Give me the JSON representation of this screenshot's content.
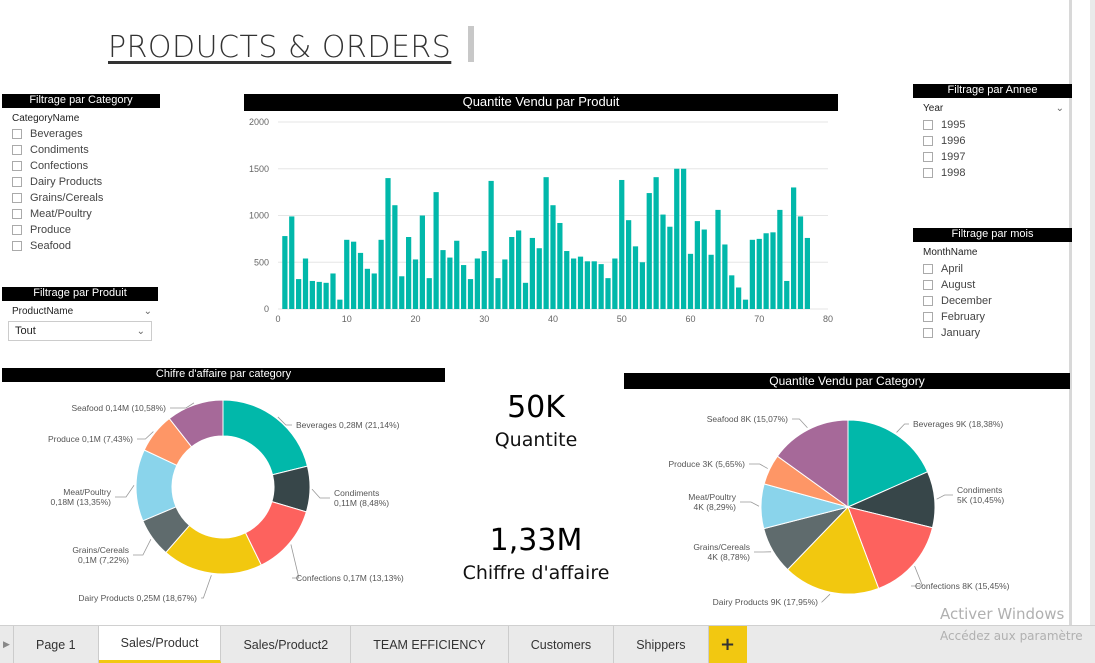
{
  "page": {
    "title": "PRODUCTS & ORDERS"
  },
  "filters": {
    "category": {
      "header": "Filtrage par Category",
      "field_label": "CategoryName",
      "items": [
        "Beverages",
        "Condiments",
        "Confections",
        "Dairy Products",
        "Grains/Cereals",
        "Meat/Poultry",
        "Produce",
        "Seafood"
      ]
    },
    "product": {
      "header": "Filtrage par Produit",
      "field_label": "ProductName",
      "selected": "Tout"
    },
    "year": {
      "header": "Filtrage par Annee",
      "field_label": "Year",
      "items": [
        "1995",
        "1996",
        "1997",
        "1998"
      ]
    },
    "month": {
      "header": "Filtrage par mois",
      "field_label": "MonthName",
      "items": [
        "April",
        "August",
        "December",
        "February",
        "January"
      ]
    }
  },
  "kpis": {
    "quantity_value": "50K",
    "quantity_label": "Quantite",
    "revenue_value": "1,33M",
    "revenue_label": "Chiffre d'affaire"
  },
  "tabs": [
    "Page 1",
    "Sales/Product",
    "Sales/Product2",
    "TEAM EFFICIENCY",
    "Customers",
    "Shippers"
  ],
  "active_tab": "Sales/Product",
  "add_tab_label": "+",
  "watermark": {
    "line1": "Activer Windows",
    "line2": "Accédez aux paramètre"
  },
  "colors": {
    "bar": "#01b8aa",
    "Beverages": "#01b8aa",
    "Condiments": "#374649",
    "Confections": "#fd625e",
    "Dairy Products": "#f2c80f",
    "Grains/Cereals": "#5f6b6d",
    "Meat/Poultry": "#8ad4eb",
    "Produce": "#fe9666",
    "Seafood": "#a66999"
  },
  "chart_data": [
    {
      "type": "bar",
      "title": "Quantite Vendu  par Produit",
      "x": [
        1,
        2,
        3,
        4,
        5,
        6,
        7,
        8,
        9,
        10,
        11,
        12,
        13,
        14,
        15,
        16,
        17,
        18,
        19,
        20,
        21,
        22,
        23,
        24,
        25,
        26,
        27,
        28,
        29,
        30,
        31,
        32,
        33,
        34,
        35,
        36,
        37,
        38,
        39,
        40,
        41,
        42,
        43,
        44,
        45,
        46,
        47,
        48,
        49,
        50,
        51,
        52,
        53,
        54,
        55,
        56,
        57,
        58,
        59,
        60,
        61,
        62,
        63,
        64,
        65,
        66,
        67,
        68,
        69,
        70,
        71,
        72,
        73,
        74,
        75,
        76,
        77
      ],
      "values": [
        780,
        990,
        320,
        540,
        300,
        290,
        280,
        380,
        100,
        740,
        720,
        600,
        430,
        380,
        740,
        1400,
        1110,
        350,
        770,
        530,
        1000,
        330,
        1250,
        630,
        550,
        730,
        470,
        320,
        540,
        620,
        1370,
        330,
        530,
        770,
        840,
        280,
        760,
        650,
        1410,
        1110,
        920,
        620,
        540,
        560,
        510,
        510,
        480,
        330,
        540,
        1380,
        950,
        670,
        500,
        1240,
        1410,
        1010,
        880,
        1500,
        1500,
        590,
        940,
        850,
        580,
        1060,
        690,
        360,
        230,
        100,
        740,
        750,
        810,
        820,
        1060,
        300,
        1300,
        990,
        760
      ],
      "xlim": [
        0,
        80
      ],
      "ylim": [
        0,
        2000
      ],
      "xticks": [
        0,
        10,
        20,
        30,
        40,
        50,
        60,
        70,
        80
      ],
      "yticks": [
        0,
        500,
        1000,
        1500,
        2000
      ],
      "grid": true
    },
    {
      "type": "pie",
      "donut": true,
      "title": "Chifre d'affaire par category",
      "categories": [
        "Beverages",
        "Condiments",
        "Confections",
        "Dairy Products",
        "Grains/Cereals",
        "Meat/Poultry",
        "Produce",
        "Seafood"
      ],
      "values": [
        21.14,
        8.48,
        13.13,
        18.67,
        7.22,
        13.35,
        7.43,
        10.58
      ],
      "labels": [
        "Beverages 0,28M (21,14%)",
        "Condiments 0,11M (8,48%)",
        "Confections 0,17M (13,13%)",
        "Dairy Products 0,25M (18,67%)",
        "Grains/Cereals 0,1M (7,22%)",
        "Meat/Poultry 0,18M (13,35%)",
        "Produce 0,1M (7,43%)",
        "Seafood 0,14M (10,58%)"
      ]
    },
    {
      "type": "pie",
      "donut": false,
      "title": "Quantite Vendu par Category",
      "categories": [
        "Beverages",
        "Condiments",
        "Confections",
        "Dairy Products",
        "Grains/Cereals",
        "Meat/Poultry",
        "Produce",
        "Seafood"
      ],
      "values": [
        18.38,
        10.45,
        15.45,
        17.95,
        8.78,
        8.29,
        5.65,
        15.07
      ],
      "labels": [
        "Beverages 9K (18,38%)",
        "Condiments 5K (10,45%)",
        "Confections 8K (15,45%)",
        "Dairy Products 9K (17,95%)",
        "Grains/Cereals 4K (8,78%)",
        "Meat/Poultry 4K (8,29%)",
        "Produce 3K (5,65%)",
        "Seafood 8K (15,07%)"
      ]
    }
  ]
}
